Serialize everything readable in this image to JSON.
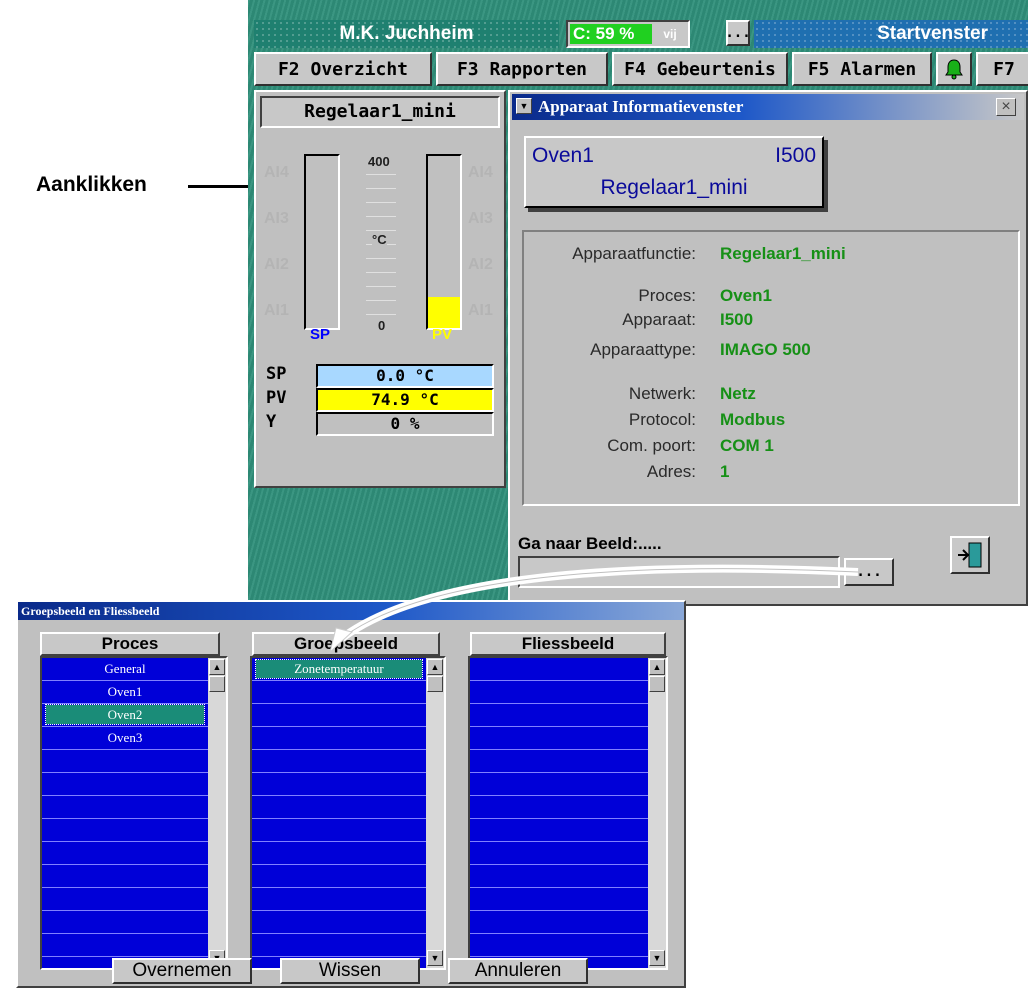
{
  "annotation": {
    "label": "Aanklikken"
  },
  "titlebar": {
    "company": "M.K. Juchheim",
    "cpu": "C:  59 %",
    "status": "vij",
    "more": "...",
    "window": "Startvenster"
  },
  "fkeys": [
    "F2 Overzicht",
    "F3 Rapporten",
    "F4 Gebeurtenis",
    "F5 Alarmen",
    "F7"
  ],
  "controller": {
    "name": "Regelaar1_mini",
    "ai_left": [
      "AI4",
      "AI3",
      "AI2",
      "AI1"
    ],
    "ai_right": [
      "AI4",
      "AI3",
      "AI2",
      "AI1"
    ],
    "scale_max": "400",
    "scale_unit": "°C",
    "scale_min": "0",
    "sp_label": "SP",
    "pv_label": "PV",
    "pv_level": 0.18,
    "sp_level": 0.0,
    "rows": [
      {
        "label": "SP",
        "value": "0.0 °C",
        "color": "#a8d8ff"
      },
      {
        "label": "PV",
        "value": "74.9 °C",
        "color": "#ffff00"
      },
      {
        "label": "Y",
        "value": "0 %",
        "color": "#c0c0c0"
      }
    ],
    "sp_color": "#0000ff",
    "pv_color": "#ffff00"
  },
  "info_window": {
    "title": "Apparaat Informatievenster",
    "close": "×",
    "card": {
      "process": "Oven1",
      "device": "I500",
      "name": "Regelaar1_mini"
    },
    "function_label": "Apparaatfunctie:",
    "function_value": "Regelaar1_mini",
    "fields": [
      {
        "label": "Proces:",
        "value": "Oven1"
      },
      {
        "label": "Apparaat:",
        "value": "I500"
      },
      {
        "label": "Apparaattype:",
        "value": "IMAGO 500"
      },
      {
        "label": "Netwerk:",
        "value": "Netz"
      },
      {
        "label": "Protocol:",
        "value": "Modbus"
      },
      {
        "label": "Com. poort:",
        "value": "COM 1"
      },
      {
        "label": "Adres:",
        "value": "1"
      }
    ],
    "goto_label": "Ga naar Beeld:.....",
    "goto_value": "",
    "browse": "...",
    "value_color": "#169016"
  },
  "dialog": {
    "title": "Groepsbeeld en Fliessbeeld",
    "columns": [
      {
        "header": "Proces",
        "items": [
          "General",
          "Oven1",
          "Oven2",
          "Oven3"
        ],
        "selected": 2
      },
      {
        "header": "Groepsbeeld",
        "items": [
          "Zonetemperatuur"
        ],
        "selected": 0
      },
      {
        "header": "Fliessbeeld",
        "items": [],
        "selected": -1
      }
    ],
    "buttons": [
      "Overnemen",
      "Wissen",
      "Annuleren"
    ]
  }
}
